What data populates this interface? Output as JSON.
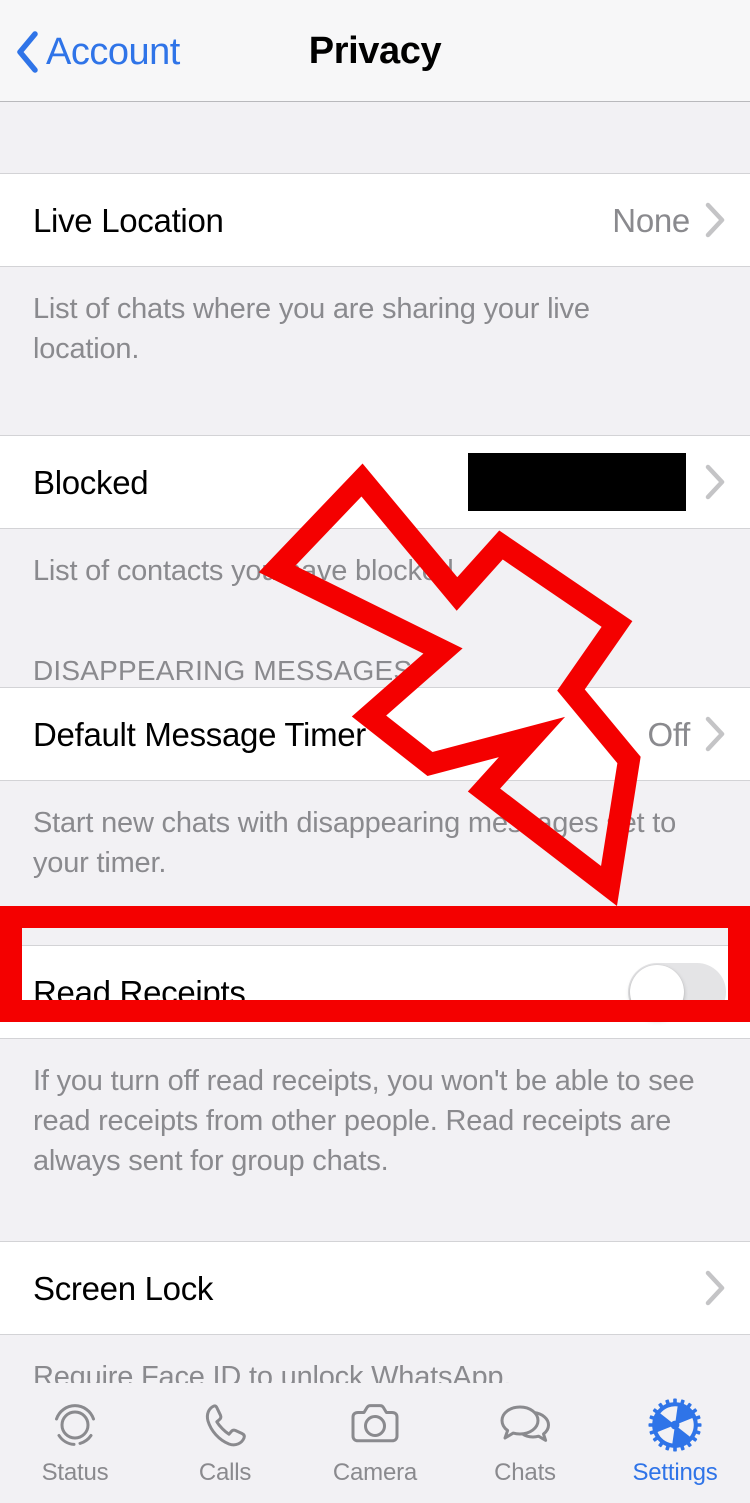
{
  "nav": {
    "back_label": "Account",
    "back_icon": "chevron-left-icon",
    "title": "Privacy"
  },
  "sections": [
    {
      "rows": [
        {
          "label": "Live Location",
          "value": "None",
          "type": "disclosure",
          "accessory_icon": "chevron-right-icon"
        }
      ],
      "footer": "List of chats where you are sharing your live location."
    },
    {
      "rows": [
        {
          "label": "Blocked",
          "value": "",
          "type": "disclosure-redacted",
          "accessory_icon": "chevron-right-icon"
        }
      ],
      "footer": "List of contacts you have blocked."
    },
    {
      "header": "DISAPPEARING MESSAGES",
      "rows": [
        {
          "label": "Default Message Timer",
          "value": "Off",
          "type": "disclosure",
          "accessory_icon": "chevron-right-icon"
        }
      ],
      "footer": "Start new chats with disappearing messages set to your timer."
    },
    {
      "rows": [
        {
          "label": "Read Receipts",
          "value": "",
          "type": "toggle",
          "toggle_state": "off",
          "highlighted": true
        }
      ],
      "footer": "If you turn off read receipts, you won't be able to see read receipts from other people. Read receipts are always sent for group chats."
    },
    {
      "rows": [
        {
          "label": "Screen Lock",
          "value": "",
          "type": "disclosure",
          "accessory_icon": "chevron-right-icon"
        }
      ],
      "footer": "Require Face ID to unlock WhatsApp."
    }
  ],
  "annotations": {
    "arrow_color": "#f40000",
    "highlight_color": "#f40000",
    "arrow_icon": "down-right-arrow-annotation",
    "highlight_target": "Read Receipts"
  },
  "tabbar": {
    "items": [
      {
        "label": "Status",
        "icon": "status-ring-icon",
        "active": false
      },
      {
        "label": "Calls",
        "icon": "phone-icon",
        "active": false
      },
      {
        "label": "Camera",
        "icon": "camera-icon",
        "active": false
      },
      {
        "label": "Chats",
        "icon": "chat-bubbles-icon",
        "active": false
      },
      {
        "label": "Settings",
        "icon": "gear-icon",
        "active": true
      }
    ]
  },
  "colors": {
    "accent_blue": "#2f74e8",
    "annotation_red": "#f40000",
    "grouped_background": "#f2f1f4",
    "row_background": "#ffffff",
    "secondary_text": "#8a8a8e"
  }
}
